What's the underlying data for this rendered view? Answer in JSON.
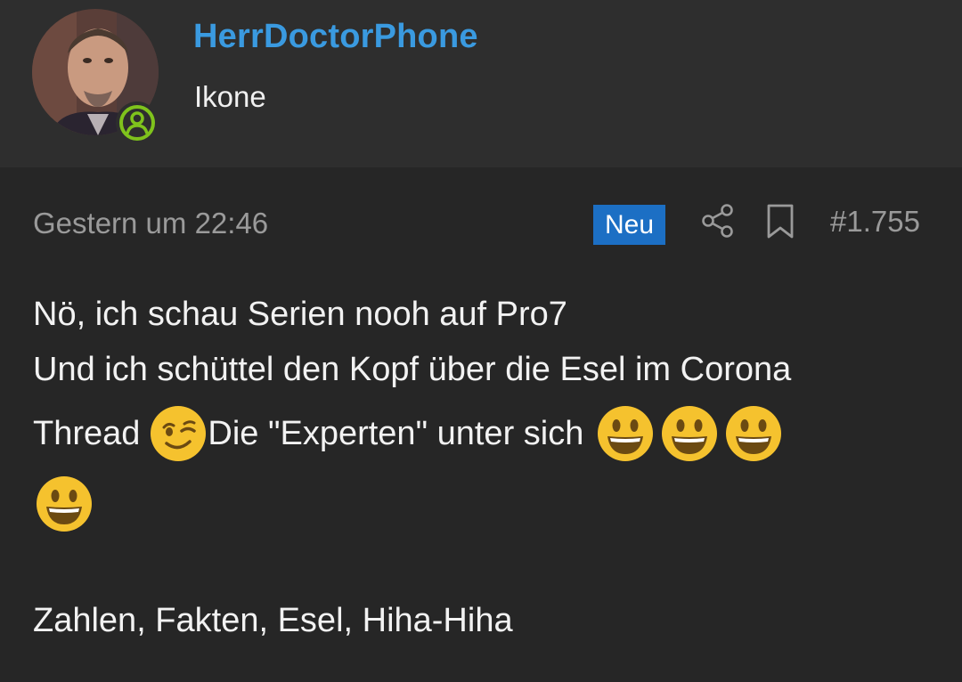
{
  "user": {
    "name": "HerrDoctorPhone",
    "title": "Ikone",
    "status_color": "#7fc31c"
  },
  "post": {
    "date": "Gestern um 22:46",
    "badge": "Neu",
    "number": "#1.755",
    "icons": [
      "share-icon",
      "bookmark-icon"
    ],
    "accent_color": "#1c6fc4",
    "lines": [
      "Nö, ich schau Serien nooh auf Pro7",
      "Und ich schüttel den Kopf über die Esel im Corona",
      "Thread",
      "Die \"Experten\" unter sich",
      "Zahlen, Fakten, Esel, Hiha-Hiha"
    ],
    "emojis": [
      "winking-face-emoji",
      "grinning-face-emoji",
      "grinning-face-emoji",
      "grinning-face-emoji",
      "grinning-face-emoji"
    ]
  }
}
